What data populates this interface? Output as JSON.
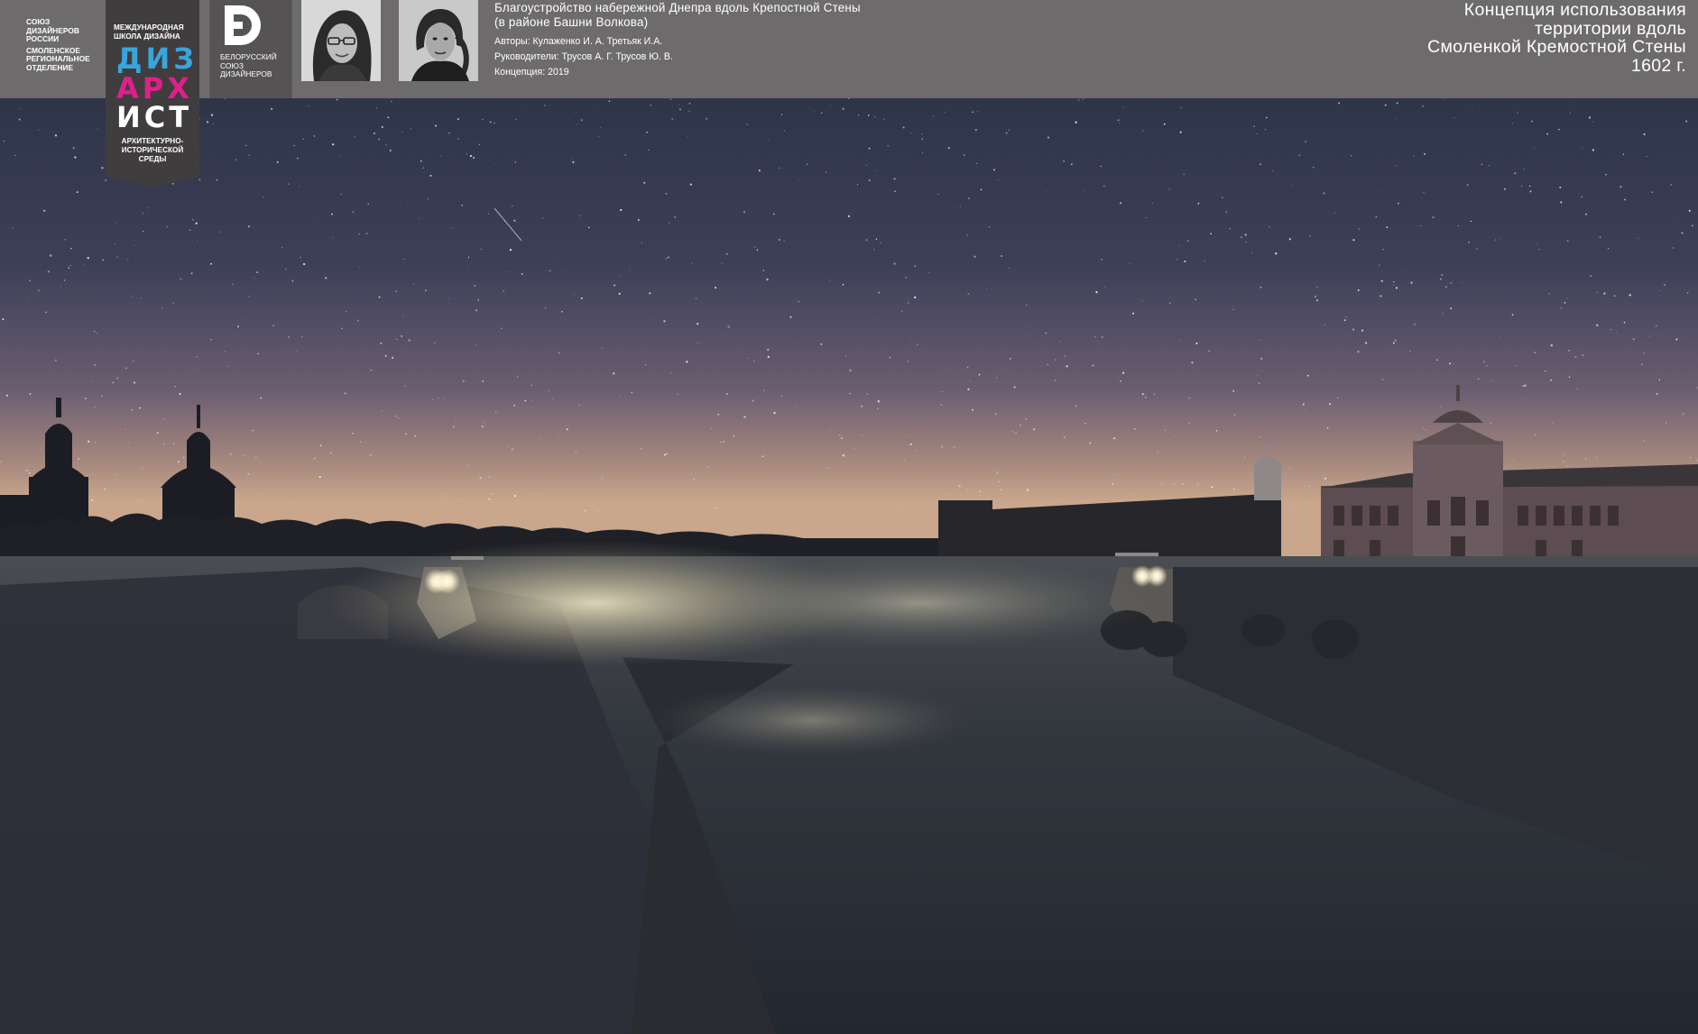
{
  "org": {
    "line1": "Союз дизайнеров России",
    "line2": "Смоленское региональное отделение"
  },
  "dizarh_logo": {
    "school": "Международная школа дизайна",
    "word1": "ДИЗ",
    "word2": "АРХ",
    "word3": "ИСТ",
    "subtitle": "Архитектурно-исторической среды",
    "colors": {
      "diz": "#3aa4dc",
      "arh": "#e0208a",
      "ist": "#ffffff",
      "background": "#403d3f"
    }
  },
  "bsd_logo": {
    "text": "Белорусский союз дизайнеров",
    "icon": "bsd-d-letter-icon"
  },
  "authors_photos": [
    {
      "icon": "author-photo-woman"
    },
    {
      "icon": "author-photo-man"
    }
  ],
  "project": {
    "title_line1": "Благоустройство набережной Днепра вдоль Крепостной Стены",
    "title_line2": "(в районе  Башни Волкова)",
    "authors": "Авторы: Кулаженко И. А. Третьяк И.А.",
    "supervisors": "Руководители: Трусов А. Г. Трусов Ю. В.",
    "concept": "Концепция: 2019"
  },
  "concept_block": {
    "line1": "Концепция использования",
    "line2": "территории вдоль",
    "line3": "Смоленкой Кремостной Стены",
    "line4": "1602 г."
  },
  "colors": {
    "header_bg": "#6e6b6c",
    "sky_top": "#2c3247",
    "horizon_glow": "#c9a68c",
    "water": "#2a2e36",
    "light_beam": "#f4e8c2"
  }
}
